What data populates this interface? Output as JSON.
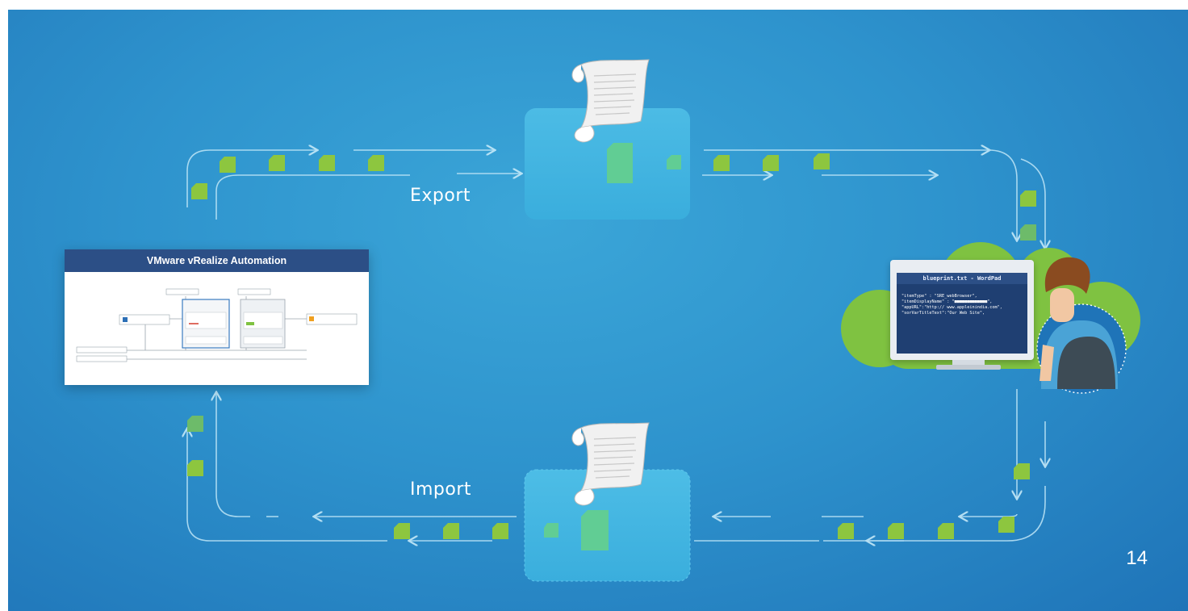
{
  "diagram": {
    "export_label": "Export",
    "import_label": "Import",
    "page_number": "14",
    "vra_window": {
      "title": "VMware vRealize Automation"
    },
    "editor_window": {
      "title": "blueprint.txt - WordPad",
      "code_lines": [
        "\"itemType\" : \"SRE_webBrowser\",",
        "\"itemDisplayName\" : \"■■■■■■■■■■■■■\",",
        "\"appURL\":\"http:// www.appleinindia.com\",",
        "\"sorVarTitleText\":\"Our Web Site\","
      ]
    },
    "colors": {
      "background": "#2e93cd",
      "panel": "#46b8e3",
      "file_icon": "#8dc63f",
      "cloud": "#7fc241",
      "window_header": "#2c4f86",
      "flow_line": "#bfe6f7"
    },
    "icons": [
      "scroll-document-icon",
      "file-icon",
      "cloud-icon",
      "person-icon",
      "monitor-icon"
    ]
  }
}
